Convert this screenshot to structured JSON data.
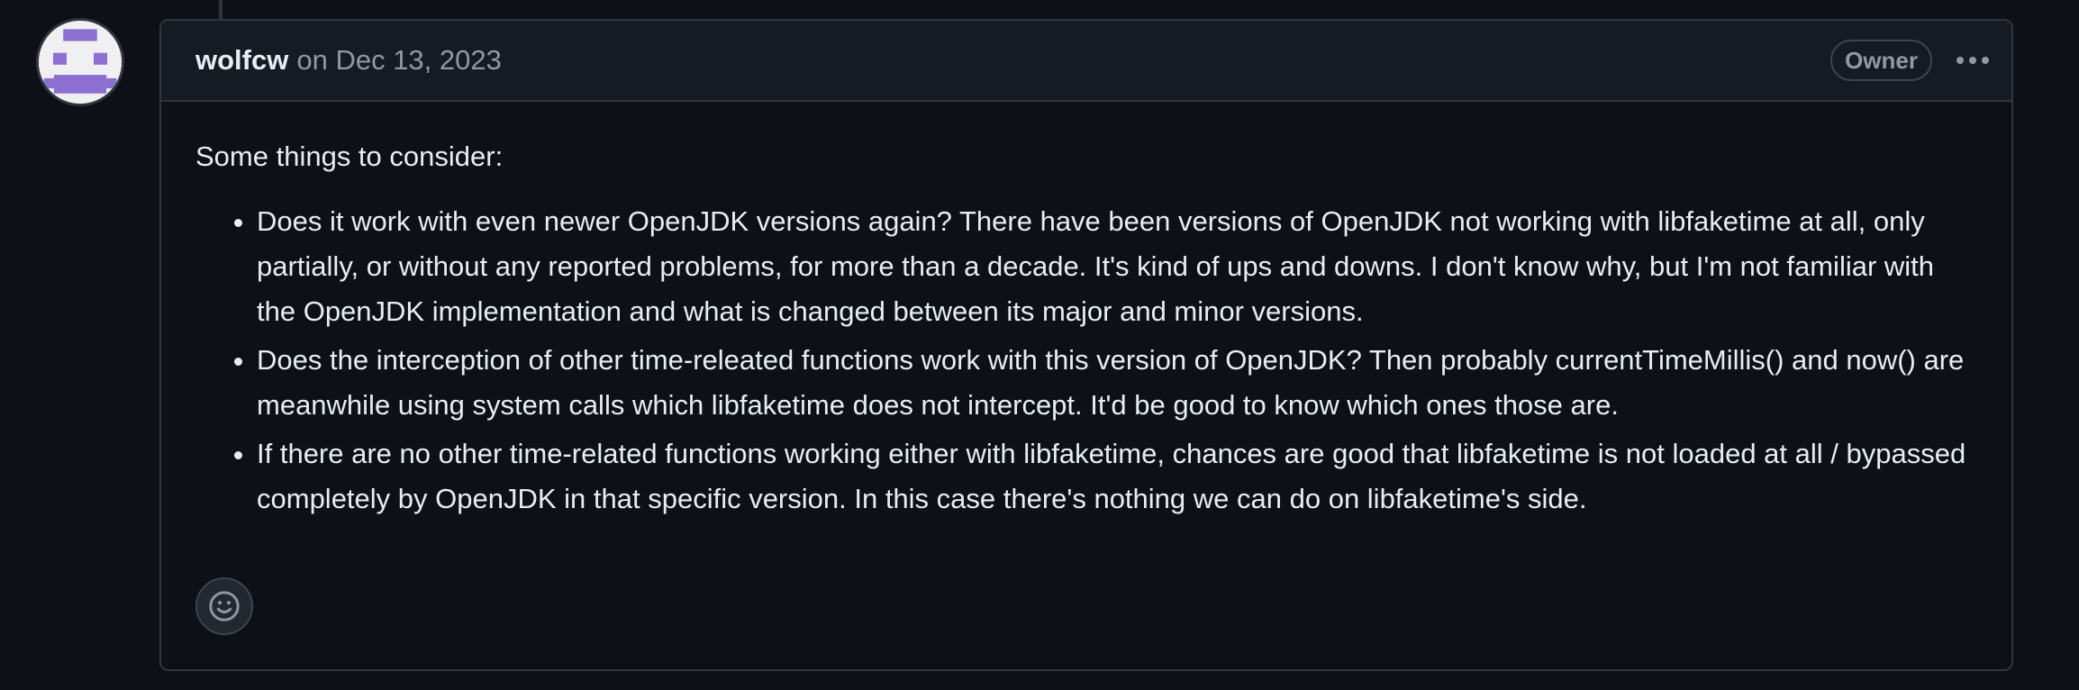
{
  "comment": {
    "author": "wolfcw",
    "meta_prefix": "on",
    "date": "Dec 13, 2023",
    "role_badge": "Owner",
    "intro": "Some things to consider:",
    "bullets": [
      "Does it work with even newer OpenJDK versions again? There have been versions of OpenJDK not working with libfaketime at all, only partially, or without any reported problems, for more than a decade. It's kind of ups and downs. I don't know why, but I'm not familiar with the OpenJDK implementation and what is changed between its major and minor versions.",
      "Does the interception of other time-releated functions work with this version of OpenJDK? Then probably currentTimeMillis() and now() are meanwhile using system calls which libfaketime does not intercept. It'd be good to know which ones those are.",
      "If there are no other time-related functions working either with libfaketime, chances are good that libfaketime is not loaded at all / bypassed completely by OpenJDK in that specific version. In this case there's nothing we can do on libfaketime's side."
    ]
  },
  "icons": {
    "avatar": "identicon-avatar",
    "menu": "kebab-horizontal-icon",
    "reaction": "smiley-icon"
  },
  "colors": {
    "background": "#0d1117",
    "header_background": "#151b23",
    "border": "#30363d",
    "identicon": "#8c6fd1",
    "muted_text": "#9198a1"
  }
}
